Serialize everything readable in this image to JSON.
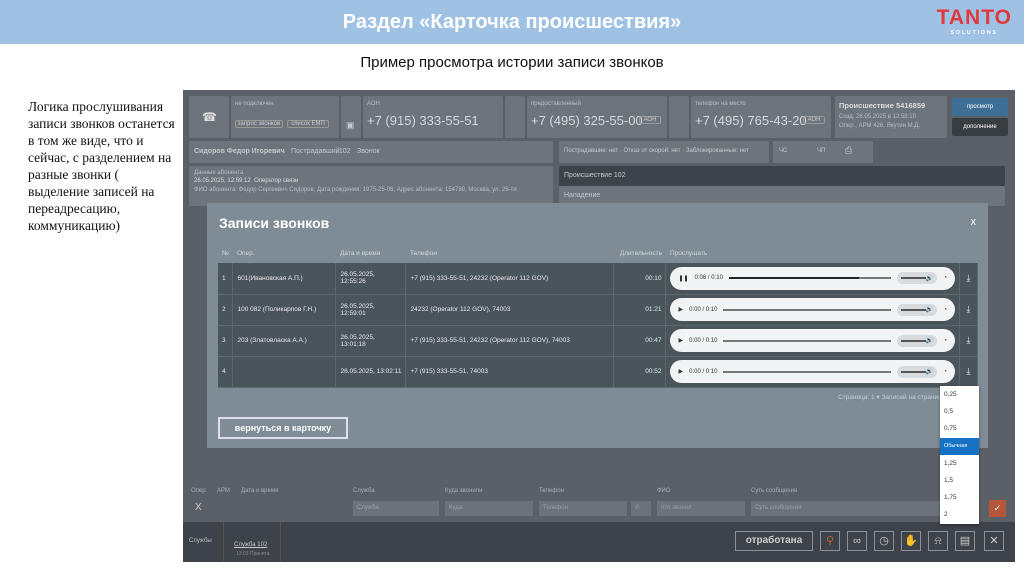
{
  "slide": {
    "title": "Раздел «Карточка происшествия»",
    "logo": "TANTO",
    "logo_sub": "SOLUTIONS",
    "subtitle": "Пример просмотра истории записи звонков",
    "description": "Логика прослушивания записи звонков останется в том же виде, что и сейчас, с разделением на разные звонки ( выделение записей на переадресацию, коммуникацию)"
  },
  "app": {
    "top": {
      "status": "не подключен",
      "btn1": "запрос звонков",
      "btn2": "список ЕМП",
      "aon_label": "АОН",
      "aon": "+7 (915) 333-55-51",
      "provided_label": "предоставленный",
      "provided": "+7 (495) 325-55-00",
      "onsite_label": "телефон на место",
      "onsite": "+7 (495) 765-43-20",
      "aon_btn": "АОН",
      "incident": "Происшествие 5416859",
      "incident_created": "Созд. 26.05.2025 в 12:58:10",
      "incident_oper": "Опер., АРМ 426, Якутин М.Д.",
      "view_btn": "просмотр",
      "add_btn": "дополнение"
    },
    "caller": {
      "name": "Сидоров Федор Игоревич",
      "role": "Пострадавший",
      "service": "102",
      "call": "Звонок"
    },
    "flags": "Пострадавшие: нет · Отказ от скорой: нет · Заблокированные: нет",
    "flag_chs": "ЧС",
    "flag_chp": "ЧП",
    "subscriber": {
      "label": "Данные абонента",
      "time": "26.05.2025, 12:59:12",
      "oper": "Оператор связи",
      "info": "ФИО абонента: Федор Сергеевич Сидоров, Дата рождения: 1975-25-06, Адрес абонента: 154789, Москва, ул. 26-ти"
    },
    "incident_panel": {
      "title": "Происшествие 102",
      "type": "Нападение"
    },
    "modal": {
      "title": "Записи звонков",
      "close": "x",
      "headers": [
        "№",
        "Опер.",
        "Дата и время",
        "Телефон",
        "Длительность",
        "Прослушать"
      ],
      "rows": [
        {
          "n": "1",
          "oper": "601(Ивановская А.П.)",
          "dt": "26.05.2025, 12:55:26",
          "phone": "+7 (915) 333-55-51, 24232 (Operator 112 GOV)",
          "dur": "00:10",
          "time": "0:08 / 0:10",
          "progress": 0.8,
          "playing": true
        },
        {
          "n": "2",
          "oper": "100 082 (Поликарпов Г.Н.)",
          "dt": "26.05.2025, 12:59:01",
          "phone": "24232 (Operator 112 GOV), 74003",
          "dur": "01:21",
          "time": "0:00 / 0:10",
          "progress": 0,
          "playing": false
        },
        {
          "n": "3",
          "oper": "203 (Златовласка А.А.)",
          "dt": "26.05.2025, 13:01:18",
          "phone": "+7 (915) 333-55-51, 24232 (Operator 112 GOV), 74003",
          "dur": "00:47",
          "time": "0:00 / 0:10",
          "progress": 0,
          "playing": false
        },
        {
          "n": "4",
          "oper": "",
          "dt": "26.05.2025, 13:02:11",
          "phone": "+7 (915) 333-55-51, 74003",
          "dur": "00:52",
          "time": "0:00 / 0:10",
          "progress": 0,
          "playing": false
        }
      ],
      "pager": "Страница: 1 ▾   Записей на странице: 10 ▾   1-4 и",
      "back": "вернуться в карточку",
      "speeds": [
        "0,25",
        "0,5",
        "0,75",
        "Обычная",
        "1,25",
        "1,5",
        "1,75",
        "2"
      ],
      "speed_selected": "Обычная"
    },
    "form": {
      "labels": [
        "Опер.",
        "АРМ",
        "Дата и время",
        "Служба",
        "Куда звонили",
        "Телефон",
        "ФИО",
        "Суть сообщения"
      ],
      "service_ph": "Служба",
      "where_ph": "Куда",
      "phone_ph": "Телефон",
      "fio_ph": "Кто звонил",
      "msg_ph": "Суть сообщения",
      "clear": "X"
    },
    "bottom": {
      "services_label": "Службы",
      "service": "Служба 102",
      "service_sub": "13:03 Принята",
      "done": "отработана"
    }
  }
}
